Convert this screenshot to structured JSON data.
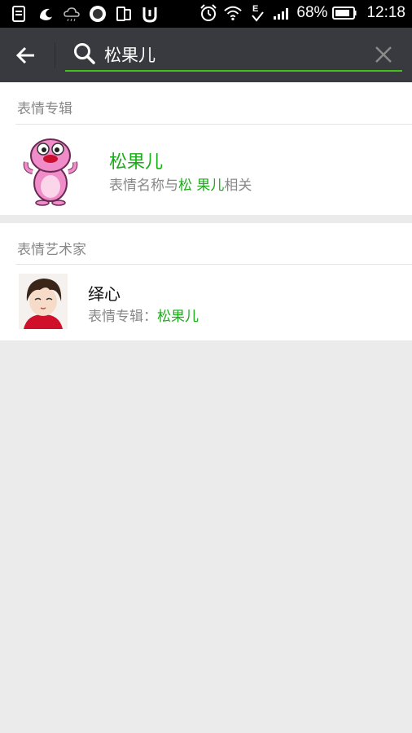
{
  "status_bar": {
    "battery_text": "68%",
    "time": "12:18",
    "icons": [
      "doc-icon",
      "uc-browser-icon",
      "cloud-icon",
      "circle-app-icon",
      "dual-screen-icon",
      "ui-app-icon",
      "alarm-icon",
      "wifi-icon",
      "e-network-icon",
      "signal-icon",
      "battery-icon"
    ]
  },
  "search": {
    "query": "松果儿"
  },
  "sections": {
    "stickers": {
      "header": "表情专辑",
      "item": {
        "title": "松果儿",
        "subtitle_prefix": "表情名称与",
        "subtitle_match": "松 果儿",
        "subtitle_suffix": "相关"
      }
    },
    "artists": {
      "header": "表情艺术家",
      "item": {
        "name": "绎心",
        "subtitle_prefix": "表情专辑：",
        "subtitle_match": "松果儿"
      }
    }
  },
  "colors": {
    "accent": "#1aad19",
    "toolbar": "#393a3f",
    "statusbar": "#000000",
    "background": "#ebebeb"
  }
}
